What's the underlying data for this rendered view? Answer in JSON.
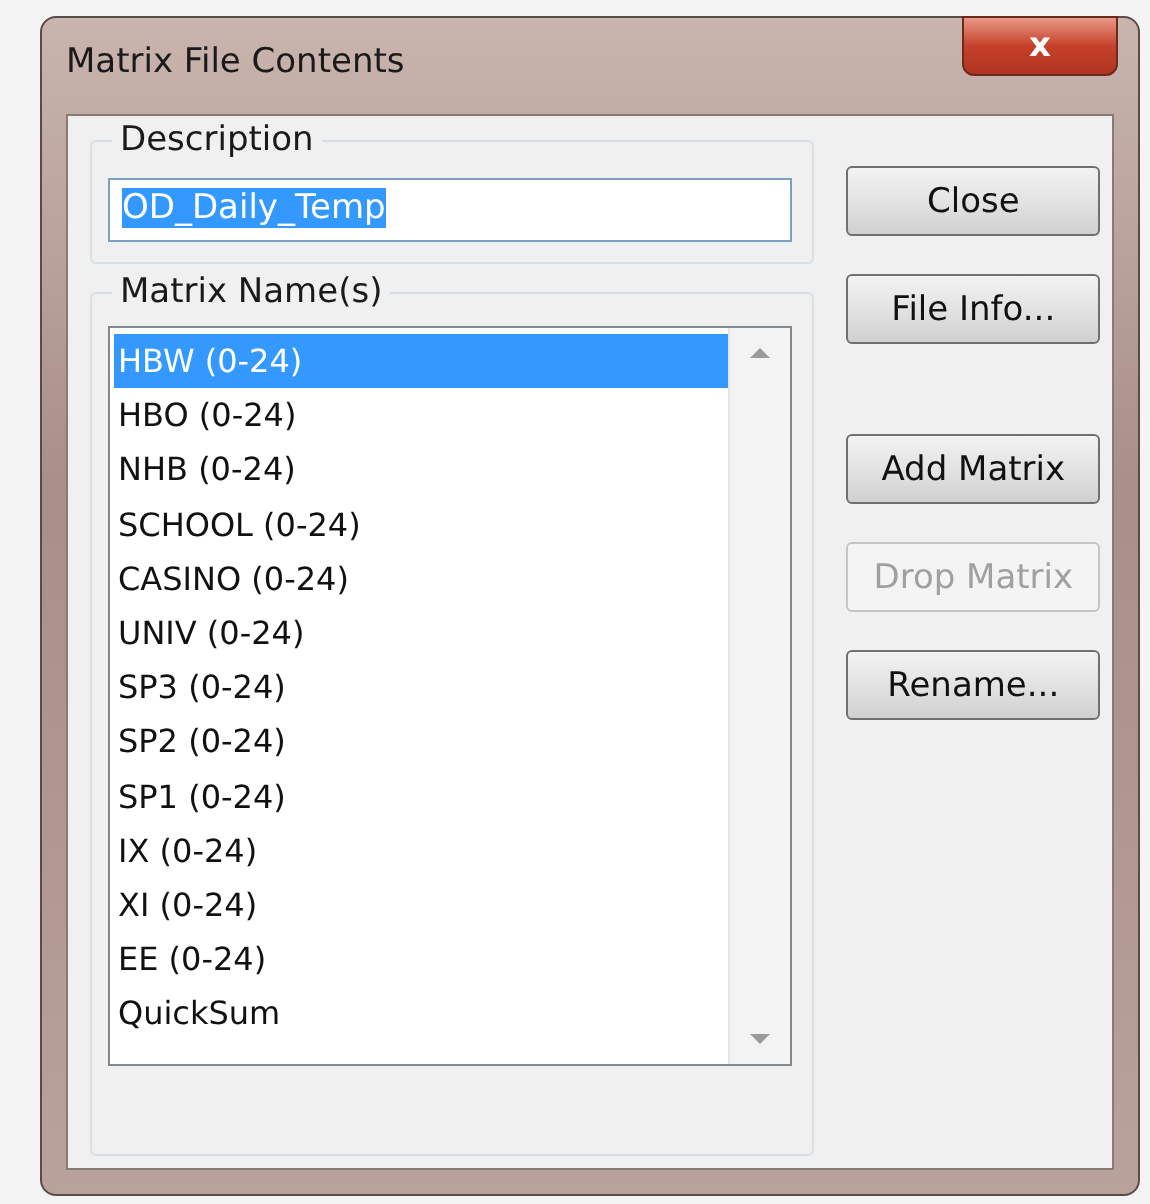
{
  "window": {
    "title": "Matrix File Contents",
    "close": "x"
  },
  "description": {
    "label": "Description",
    "value": "OD_Daily_Temp",
    "selected": true
  },
  "matrices": {
    "label": "Matrix Name(s)",
    "items": [
      {
        "name": "HBW (0-24)",
        "selected": true
      },
      {
        "name": "HBO (0-24)",
        "selected": false
      },
      {
        "name": "NHB (0-24)",
        "selected": false
      },
      {
        "name": "SCHOOL (0-24)",
        "selected": false
      },
      {
        "name": "CASINO (0-24)",
        "selected": false
      },
      {
        "name": "UNIV (0-24)",
        "selected": false
      },
      {
        "name": "SP3 (0-24)",
        "selected": false
      },
      {
        "name": "SP2 (0-24)",
        "selected": false
      },
      {
        "name": "SP1 (0-24)",
        "selected": false
      },
      {
        "name": "IX (0-24)",
        "selected": false
      },
      {
        "name": "XI (0-24)",
        "selected": false
      },
      {
        "name": "EE (0-24)",
        "selected": false
      },
      {
        "name": "QuickSum",
        "selected": false
      }
    ]
  },
  "top_buttons": [
    {
      "label": "Close",
      "disabled": false
    },
    {
      "label": "File Info...",
      "disabled": false
    }
  ],
  "bottom_buttons": [
    {
      "label": "Add Matrix",
      "disabled": false
    },
    {
      "label": "Drop Matrix",
      "disabled": true
    },
    {
      "label": "Rename...",
      "disabled": false
    }
  ]
}
